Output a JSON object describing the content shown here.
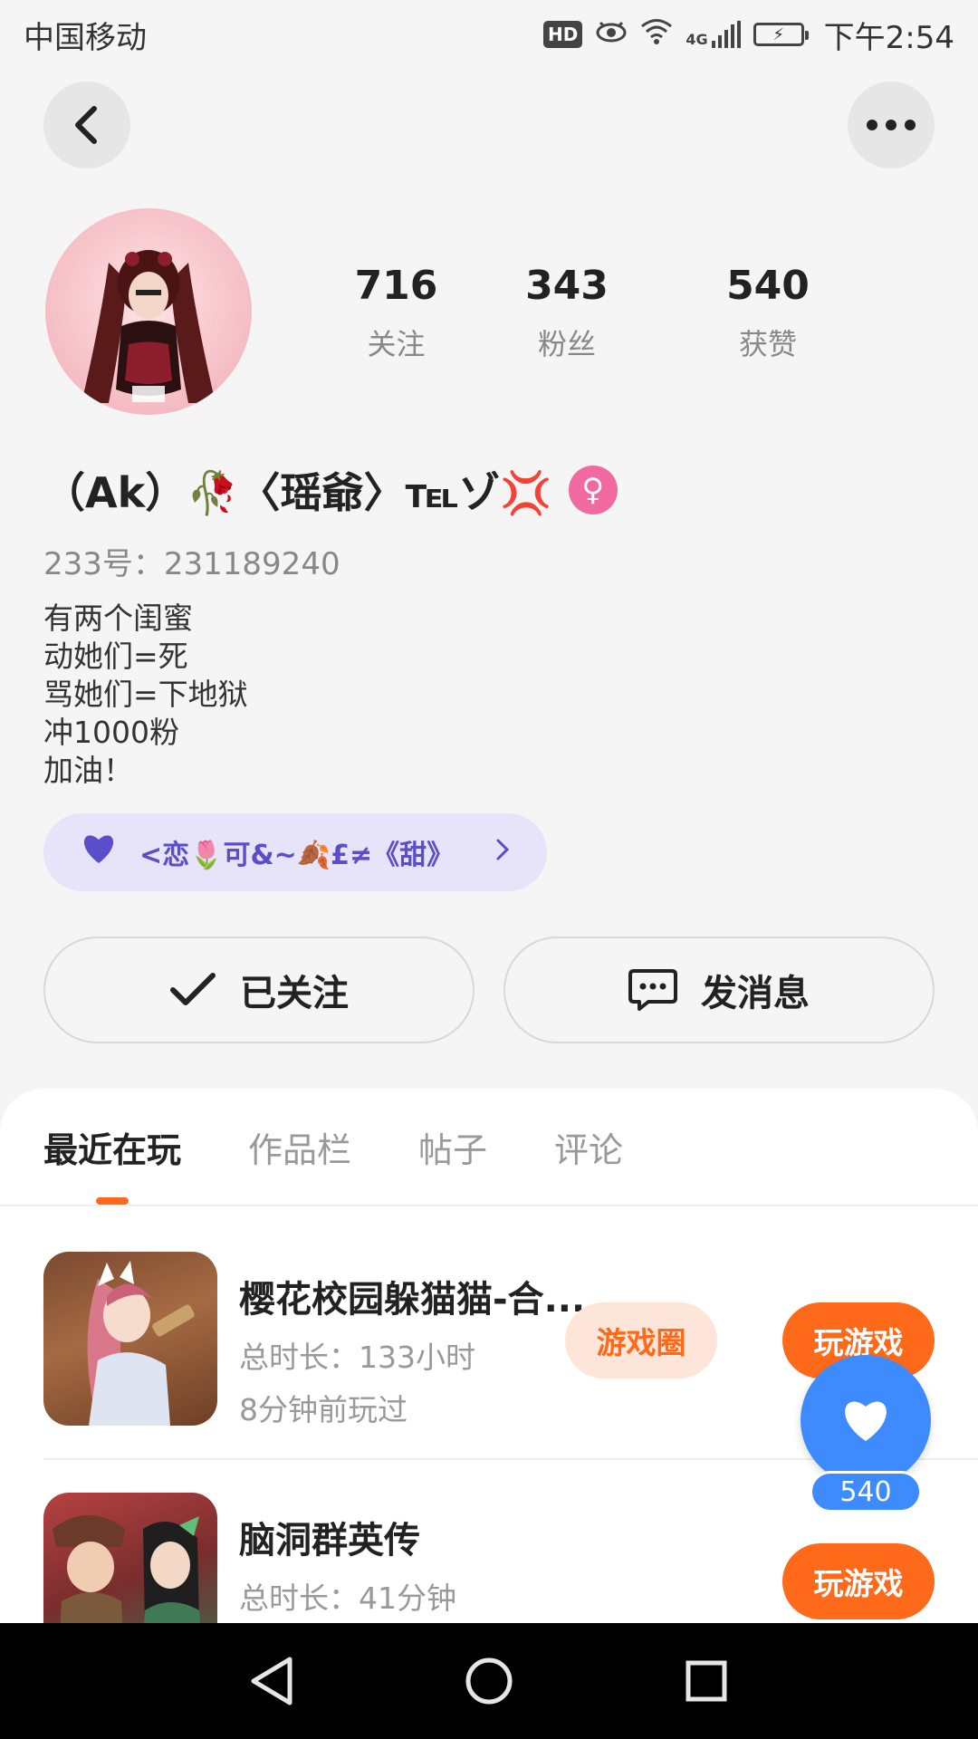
{
  "status_bar": {
    "carrier": "中国移动",
    "hd": "HD",
    "network": "4G",
    "time": "下午2:54"
  },
  "profile": {
    "stats": [
      {
        "value": "716",
        "label": "关注"
      },
      {
        "value": "343",
        "label": "粉丝"
      },
      {
        "value": "540",
        "label": "获赞"
      }
    ],
    "nickname": "（Ak）🥀〈瑶爺〉℡ゾ💢",
    "gender_symbol": "♀",
    "user_id": "233号：231189240",
    "bio": [
      "有两个闺蜜",
      "动她们=死",
      "骂她们=下地狱",
      "冲1000粉",
      "加油！"
    ],
    "relation": {
      "text": "<恋🌷可&~🍂£≠《甜》"
    },
    "follow_label": "已关注",
    "message_label": "发消息"
  },
  "tabs": [
    "最近在玩",
    "作品栏",
    "帖子",
    "评论"
  ],
  "games": [
    {
      "name": "樱花校园躲猫猫-合...",
      "duration": "总时长：133小时",
      "last_played": "8分钟前玩过",
      "circle_label": "游戏圈",
      "play_label": "玩游戏"
    },
    {
      "name": "脑洞群英传",
      "duration": "总时长：41分钟",
      "play_label": "玩游戏"
    }
  ],
  "float_like": {
    "count": "540"
  },
  "colors": {
    "accent": "#ff6a1a",
    "like_blue": "#3d8bff",
    "relation_bg": "#e7e3f8",
    "relation_text": "#5a4ec9"
  }
}
